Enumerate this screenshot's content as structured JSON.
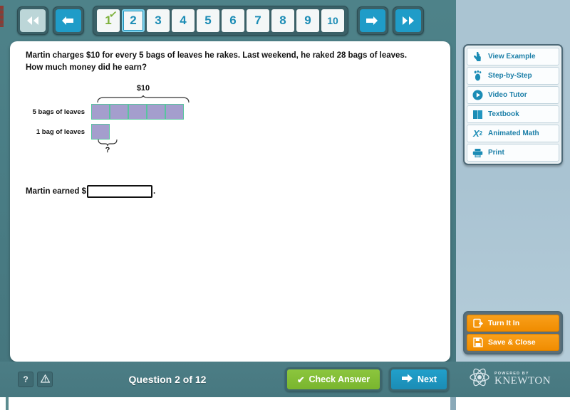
{
  "topnav": {
    "first_label": "first-page",
    "prev_label": "previous",
    "next_label": "next",
    "last_label": "last-page",
    "pages": [
      {
        "num": "1",
        "state": "done"
      },
      {
        "num": "2",
        "state": "current"
      },
      {
        "num": "3",
        "state": "normal"
      },
      {
        "num": "4",
        "state": "normal"
      },
      {
        "num": "5",
        "state": "normal"
      },
      {
        "num": "6",
        "state": "normal"
      },
      {
        "num": "7",
        "state": "normal"
      },
      {
        "num": "8",
        "state": "normal"
      },
      {
        "num": "9",
        "state": "normal"
      },
      {
        "num": "10",
        "state": "normal"
      }
    ],
    "check_glyph": "✓"
  },
  "question": {
    "text": "Martin charges $10 for every 5 bags of leaves he rakes. Last weekend, he raked 28 bags of leaves. How much money did he earn?",
    "bar_model": {
      "top_brace_label": "$10",
      "bottom_brace_label": "?",
      "rows": [
        {
          "label": "5 bags of leaves",
          "cells": 5
        },
        {
          "label": "1 bag of leaves",
          "cells": 1
        }
      ],
      "cell_fill": "#a49ecd",
      "cell_border": "#58c49f"
    },
    "answer_prefix": "Martin earned $",
    "answer_suffix": ".",
    "answer_value": "",
    "answer_placeholder": ""
  },
  "sidebar": {
    "tools": [
      {
        "label": "View Example",
        "icon": "hand-pointer-icon"
      },
      {
        "label": "Step-by-Step",
        "icon": "footprint-icon"
      },
      {
        "label": "Video Tutor",
        "icon": "play-circle-icon"
      },
      {
        "label": "Textbook",
        "icon": "book-icon"
      },
      {
        "label": "Animated Math",
        "icon": "x-squared-icon"
      },
      {
        "label": "Print",
        "icon": "printer-icon"
      }
    ],
    "actions": [
      {
        "label": "Turn It In",
        "icon": "turn-in-icon"
      },
      {
        "label": "Save & Close",
        "icon": "floppy-disk-icon"
      }
    ]
  },
  "bottombar": {
    "help_label": "?",
    "warning_label": "⚠",
    "question_counter": "Question 2 of 12",
    "check_answer_label": "Check Answer",
    "check_glyph": "✔",
    "next_label": "Next",
    "branding": {
      "powered_by": "POWERED BY",
      "name": "KNEWTON"
    }
  },
  "colors": {
    "app_bg": "#4a7d85",
    "accent_blue": "#1b8cb5",
    "accent_green": "#8cc63e",
    "accent_orange": "#f9a01b",
    "sidebar_bg": "#aac4d2"
  }
}
